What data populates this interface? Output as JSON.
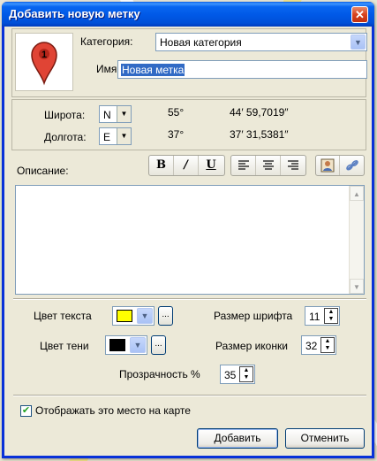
{
  "window": {
    "title": "Добавить новую метку",
    "close_glyph": "✕"
  },
  "marker": {
    "number": "1",
    "color": "#e04435"
  },
  "category": {
    "label": "Категория:",
    "value": "Новая категория"
  },
  "name": {
    "label": "Имя:",
    "value": "Новая метка"
  },
  "latitude": {
    "label": "Широта:",
    "hemisphere": "N",
    "degrees": "55°",
    "minutes_seconds": "44′ 59,7019″"
  },
  "longitude": {
    "label": "Долгота:",
    "hemisphere": "E",
    "degrees": "37°",
    "minutes_seconds": "37′ 31,5381″"
  },
  "description": {
    "label": "Описание:",
    "value": ""
  },
  "toolbar": {
    "bold": "B",
    "italic": "I",
    "underline": "U",
    "align_left_icon": "align-left-icon",
    "align_center_icon": "align-center-icon",
    "align_right_icon": "align-right-icon",
    "image_icon": "insert-image-icon",
    "link_icon": "insert-link-icon"
  },
  "text_color": {
    "label": "Цвет текста",
    "color": "#ffff00",
    "more": "..."
  },
  "shadow_color": {
    "label": "Цвет тени",
    "color": "#000000",
    "more": "..."
  },
  "font_size": {
    "label": "Размер шрифта",
    "value": "11"
  },
  "icon_size": {
    "label": "Размер иконки",
    "value": "32"
  },
  "opacity": {
    "label": "Прозрачность %",
    "value": "35"
  },
  "show_on_map": {
    "label": "Отображать это место на карте",
    "checked": true
  },
  "buttons": {
    "add": "Добавить",
    "cancel": "Отменить"
  }
}
